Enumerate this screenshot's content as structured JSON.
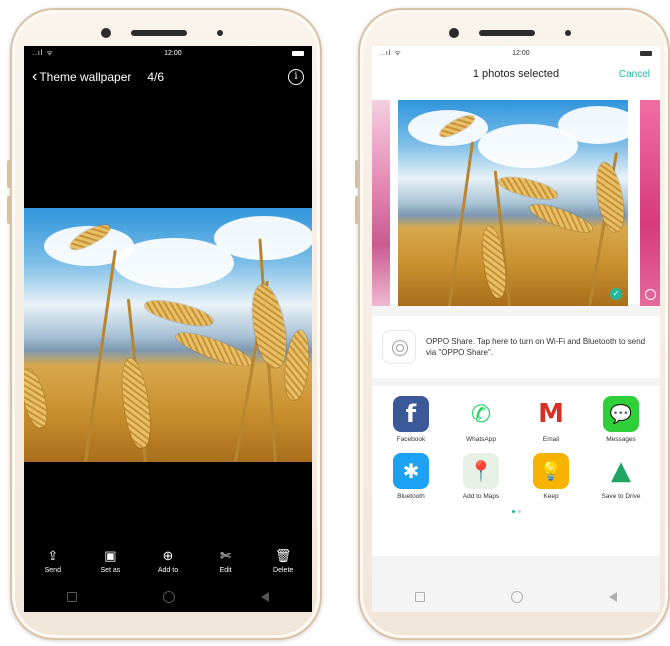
{
  "left_phone": {
    "status": {
      "signal": "..ıl ᯤ",
      "time": "12:00"
    },
    "header": {
      "back_glyph": "‹",
      "title": "Theme wallpaper",
      "count": "4/6",
      "info_glyph": "i"
    },
    "toolbar": [
      {
        "label": "Send",
        "glyph": "⇪"
      },
      {
        "label": "Set as",
        "glyph": "▣"
      },
      {
        "label": "Add to",
        "glyph": "⊕"
      },
      {
        "label": "Edit",
        "glyph": "✄"
      },
      {
        "label": "Delete",
        "glyph": "🗑"
      }
    ]
  },
  "right_phone": {
    "status": {
      "signal": "..ıl ᯤ",
      "time": "12:00"
    },
    "header": {
      "title": "1 photos selected",
      "cancel": "Cancel"
    },
    "check_glyph": "✓",
    "oppo_share": {
      "text": "OPPO Share. Tap here to turn on Wi-Fi and Bluetooth to send via \"OPPO Share\"."
    },
    "apps": [
      {
        "label": "Facebook",
        "glyph": "f",
        "color": "#3b5998"
      },
      {
        "label": "WhatsApp",
        "glyph": "✆",
        "color": "#25d366"
      },
      {
        "label": "Email",
        "glyph": "M",
        "color": "#d93025"
      },
      {
        "label": "Messages",
        "glyph": "💬",
        "color": "#2fcf3a"
      },
      {
        "label": "Bluetooth",
        "glyph": "✱",
        "color": "#1da1f2"
      },
      {
        "label": "Add to Maps",
        "glyph": "📍",
        "color": "#34a853"
      },
      {
        "label": "Keep",
        "glyph": "💡",
        "color": "#f6b400"
      },
      {
        "label": "Save to Drive",
        "glyph": "▲",
        "color": "#1fa463"
      }
    ]
  }
}
